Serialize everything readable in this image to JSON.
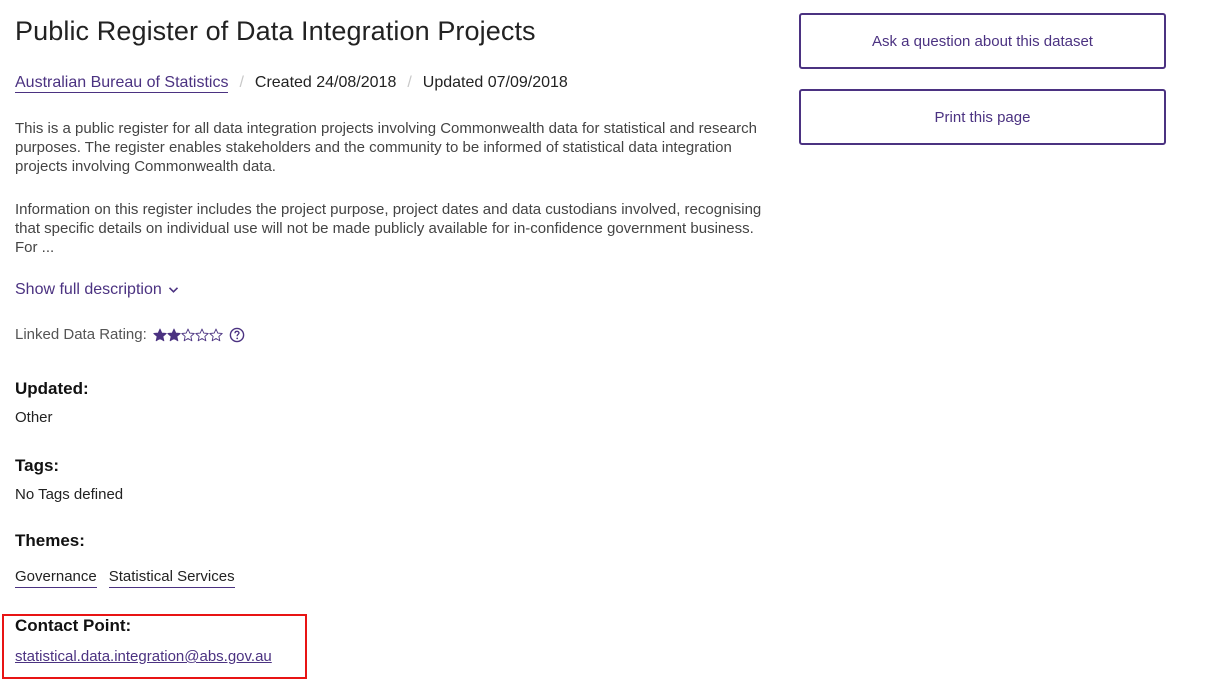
{
  "dataset": {
    "title": "Public Register of Data Integration Projects",
    "publisher": "Australian Bureau of Statistics",
    "created": "Created 24/08/2018",
    "updated": "Updated 07/09/2018",
    "separator": "/",
    "description_p1": "This is a public register for all data integration projects involving Commonwealth data for statistical and research purposes. The register enables stakeholders and the community to be informed of statistical data integration projects involving Commonwealth data.",
    "description_p2": "Information on this register includes the project purpose, project dates and data custodians involved, recognising that specific details on individual use will not be made publicly available for in-confidence government business. For ...",
    "show_full_label": "Show full description"
  },
  "rating": {
    "label": "Linked Data Rating:",
    "value": 2,
    "max": 5,
    "star_color": "#4b3281"
  },
  "details": {
    "updated_label": "Updated:",
    "updated_value": "Other",
    "tags_label": "Tags:",
    "tags_value": "No Tags defined",
    "themes_label": "Themes:",
    "themes": [
      "Governance",
      "Statistical Services"
    ],
    "contact_label": "Contact Point:",
    "contact_email": "statistical.data.integration@abs.gov.au"
  },
  "sidebar": {
    "ask_button": "Ask a question about this dataset",
    "print_button": "Print this page"
  },
  "colors": {
    "accent": "#4b3281",
    "highlight_box": "#e81414"
  },
  "icons": {
    "show_full": "chevron-down-icon",
    "rating_help": "question-circle-icon",
    "star": "star-icon"
  }
}
